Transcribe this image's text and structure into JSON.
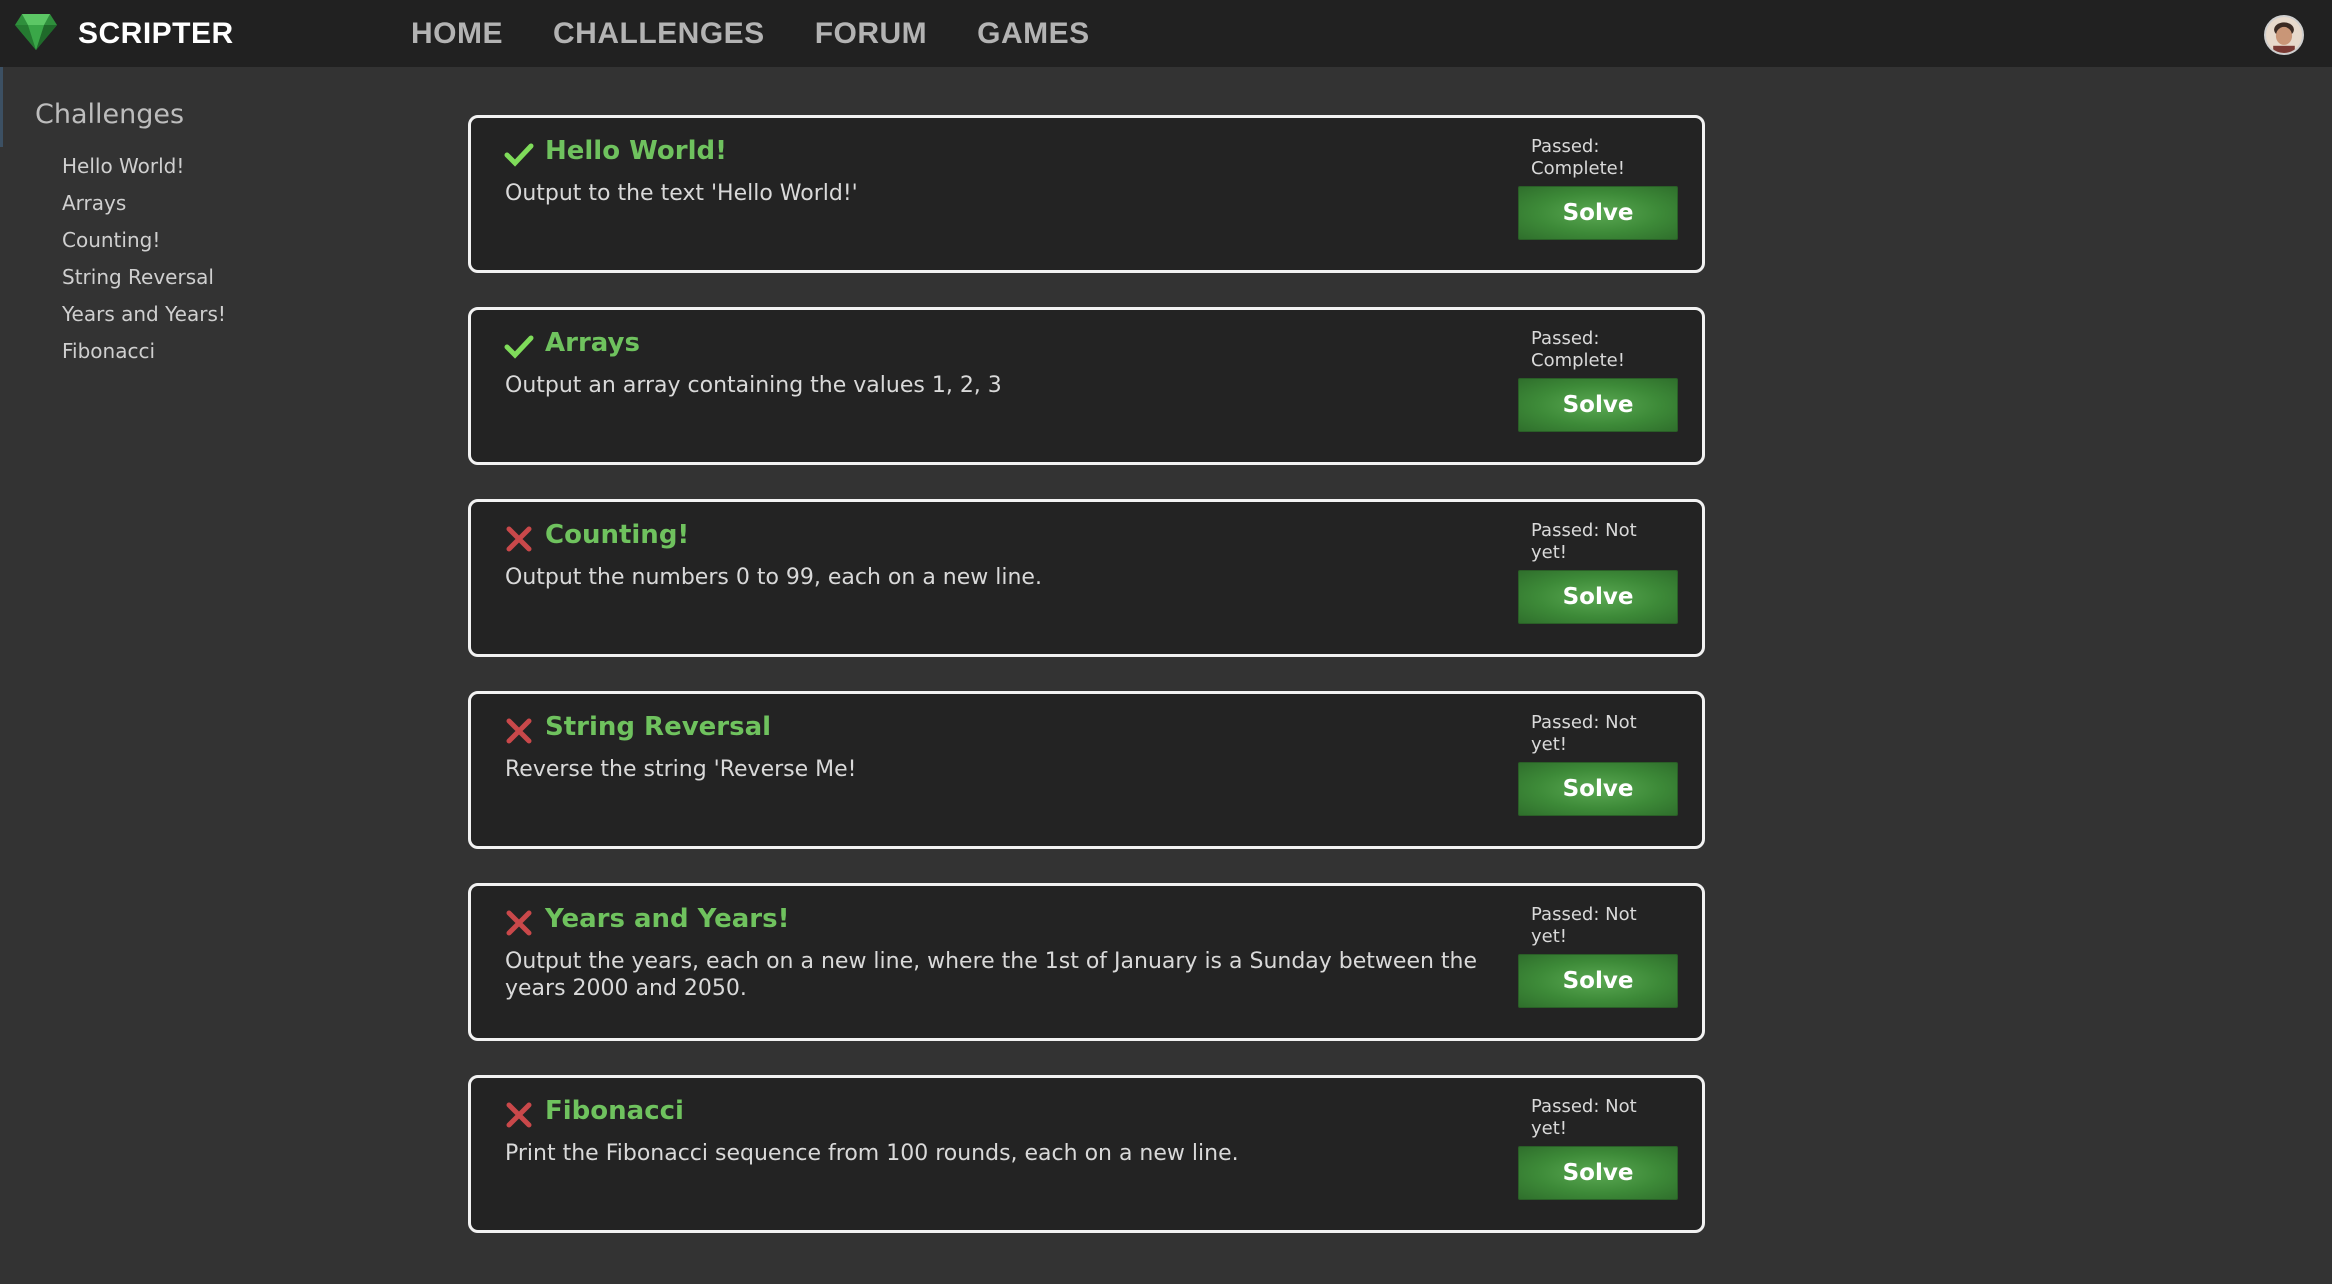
{
  "app": {
    "name": "SCRIPTER"
  },
  "nav": [
    "HOME",
    "CHALLENGES",
    "FORUM",
    "GAMES"
  ],
  "colors": {
    "accent": "#6fc25e",
    "pass": "#7fdc5a",
    "fail": "#c9484a",
    "button": "#3d8a38"
  },
  "sidebar": {
    "title": "Challenges",
    "items": [
      "Hello World!",
      "Arrays",
      "Counting!",
      "String Reversal",
      "Years and Years!",
      "Fibonacci"
    ]
  },
  "challenges": [
    {
      "title": "Hello World!",
      "desc": "Output to the text 'Hello World!'",
      "passed": "Passed: Complete!",
      "status": "check-icon",
      "button": "Solve"
    },
    {
      "title": "Arrays",
      "desc": "Output an array containing the values 1, 2, 3",
      "passed": "Passed: Complete!",
      "status": "check-icon",
      "button": "Solve"
    },
    {
      "title": "Counting!",
      "desc": "Output the numbers 0 to 99, each on a new line.",
      "passed": "Passed: Not yet!",
      "status": "cross-icon",
      "button": "Solve"
    },
    {
      "title": "String Reversal",
      "desc": "Reverse the string 'Reverse Me!",
      "passed": "Passed: Not yet!",
      "status": "cross-icon",
      "button": "Solve"
    },
    {
      "title": "Years and Years!",
      "desc": "Output the years, each on a new line, where the 1st of January is a Sunday between the years 2000 and 2050.",
      "passed": "Passed: Not yet!",
      "status": "cross-icon",
      "button": "Solve"
    },
    {
      "title": "Fibonacci",
      "desc": "Print the Fibonacci sequence from 100 rounds, each on a new line.",
      "passed": "Passed: Not yet!",
      "status": "cross-icon",
      "button": "Solve"
    }
  ]
}
